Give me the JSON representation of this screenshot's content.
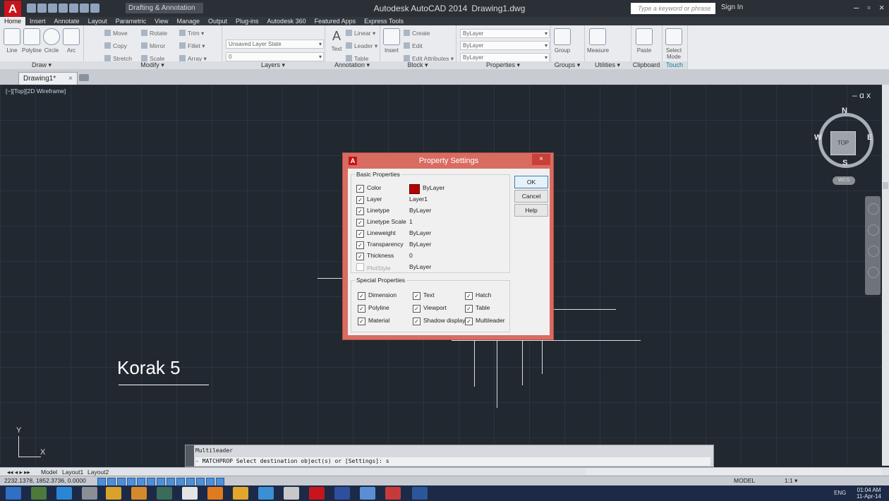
{
  "window": {
    "app_title": "Autodesk AutoCAD 2014",
    "file_name": "Drawing1.dwg",
    "workspace": "Drafting & Annotation",
    "search_placeholder": "Type a keyword or phrase",
    "sign_in": "Sign In"
  },
  "ribbon": {
    "tabs": [
      "Home",
      "Insert",
      "Annotate",
      "Layout",
      "Parametric",
      "View",
      "Manage",
      "Output",
      "Plug-ins",
      "Autodesk 360",
      "Featured Apps",
      "Express Tools"
    ],
    "active_tab": "Home",
    "panels": {
      "draw": {
        "title": "Draw ▾",
        "line": "Line",
        "polyline": "Polyline",
        "circle": "Circle",
        "arc": "Arc"
      },
      "modify": {
        "title": "Modify ▾",
        "move": "Move",
        "rotate": "Rotate",
        "trim": "Trim ▾",
        "copy": "Copy",
        "mirror": "Mirror",
        "fillet": "Fillet ▾",
        "stretch": "Stretch",
        "scale": "Scale",
        "array": "Array ▾"
      },
      "layers": {
        "title": "Layers ▾",
        "layer_state": "Unsaved Layer State",
        "current_layer": "0"
      },
      "annotation": {
        "title": "Annotation ▾",
        "text": "Text",
        "linear": "Linear ▾",
        "leader": "Leader ▾",
        "table": "Table"
      },
      "block": {
        "title": "Block ▾",
        "insert": "Insert",
        "create": "Create",
        "edit": "Edit",
        "edit_attributes": "Edit Attributes ▾"
      },
      "properties": {
        "title": "Properties ▾",
        "color": "ByLayer",
        "linetype": "ByLayer",
        "lineweight": "ByLayer"
      },
      "groups": {
        "title": "Groups ▾",
        "group": "Group"
      },
      "utilities": {
        "title": "Utilities ▾",
        "measure": "Measure"
      },
      "clipboard": {
        "title": "Clipboard",
        "paste": "Paste"
      },
      "touch": {
        "title": "Touch",
        "select_mode": "Select Mode"
      }
    }
  },
  "doc_tab": {
    "label": "Drawing1*",
    "close": "×"
  },
  "viewport": {
    "label": "[−][Top][2D Wireframe]",
    "controls": "– ɑ x",
    "viewcube": {
      "n": "N",
      "s": "S",
      "e": "E",
      "w": "W",
      "face": "TOP",
      "wcs": "WCS"
    }
  },
  "drawing": {
    "text": "Korak 5",
    "ucs_x": "X",
    "ucs_y": "Y"
  },
  "dialog": {
    "title": "Property Settings",
    "close": "×",
    "basic_title": "Basic Properties",
    "basic": [
      {
        "label": "Color",
        "value": "ByLayer",
        "checked": true
      },
      {
        "label": "Layer",
        "value": "Layer1",
        "checked": true
      },
      {
        "label": "Linetype",
        "value": "ByLayer",
        "checked": true
      },
      {
        "label": "Linetype Scale",
        "value": "1",
        "checked": true
      },
      {
        "label": "Lineweight",
        "value": "ByLayer",
        "checked": true
      },
      {
        "label": "Transparency",
        "value": "ByLayer",
        "checked": true
      },
      {
        "label": "Thickness",
        "value": "0",
        "checked": true
      },
      {
        "label": "PlotStyle",
        "value": "ByLayer",
        "checked": false
      }
    ],
    "color_swatch": "#b30000",
    "special_title": "Special Properties",
    "special": [
      {
        "label": "Dimension"
      },
      {
        "label": "Text"
      },
      {
        "label": "Hatch"
      },
      {
        "label": "Polyline"
      },
      {
        "label": "Viewport"
      },
      {
        "label": "Table"
      },
      {
        "label": "Material"
      },
      {
        "label": "Shadow display"
      },
      {
        "label": "Multileader"
      }
    ],
    "buttons": {
      "ok": "OK",
      "cancel": "Cancel",
      "help": "Help"
    }
  },
  "command": {
    "history": "Multileader",
    "prompt": "- MATCHPROP Select destination object(s) or [Settings]: s"
  },
  "layout_tabs": [
    "Model",
    "Layout1",
    "Layout2"
  ],
  "status": {
    "coords": "2232.1378, 1852.3736, 0.0000",
    "model": "MODEL",
    "scale": "1:1 ▾"
  },
  "taskbar": {
    "lang": "ENG",
    "time": "01:04 AM",
    "date": "11-Apr-14"
  },
  "colors": {
    "canvas": "#212830",
    "accent": "#c8141b",
    "dialog_frame": "#d96c61"
  }
}
